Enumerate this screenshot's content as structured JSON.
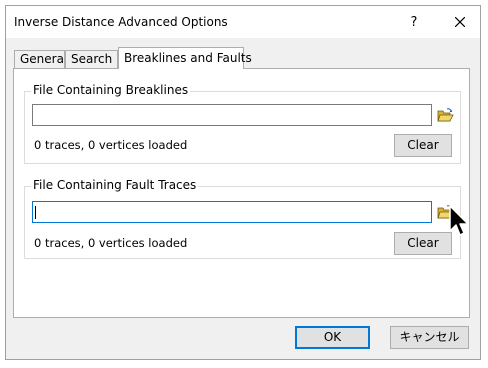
{
  "window": {
    "title": "Inverse Distance Advanced Options",
    "help_label": "?"
  },
  "tabs": [
    {
      "label": "General"
    },
    {
      "label": "Search"
    },
    {
      "label": "Breaklines and Faults",
      "active": true
    }
  ],
  "breaklines": {
    "group_title": "File Containing Breaklines",
    "file_value": "",
    "status": "0 traces, 0 vertices loaded",
    "clear_label": "Clear"
  },
  "faults": {
    "group_title": "File Containing Fault Traces",
    "file_value": "",
    "status": "0 traces, 0 vertices loaded",
    "clear_label": "Clear"
  },
  "footer": {
    "ok_label": "OK",
    "cancel_label": "キャンセル"
  },
  "icons": {
    "close": "close-icon",
    "help": "help-icon",
    "browse": "folder-open-icon",
    "pointer": "mouse-pointer-icon"
  },
  "colors": {
    "focus_border": "#0078d7",
    "dialog_bg": "#f0f0f0",
    "button_bg": "#e1e1e1",
    "folder_yellow": "#e8c54a"
  }
}
